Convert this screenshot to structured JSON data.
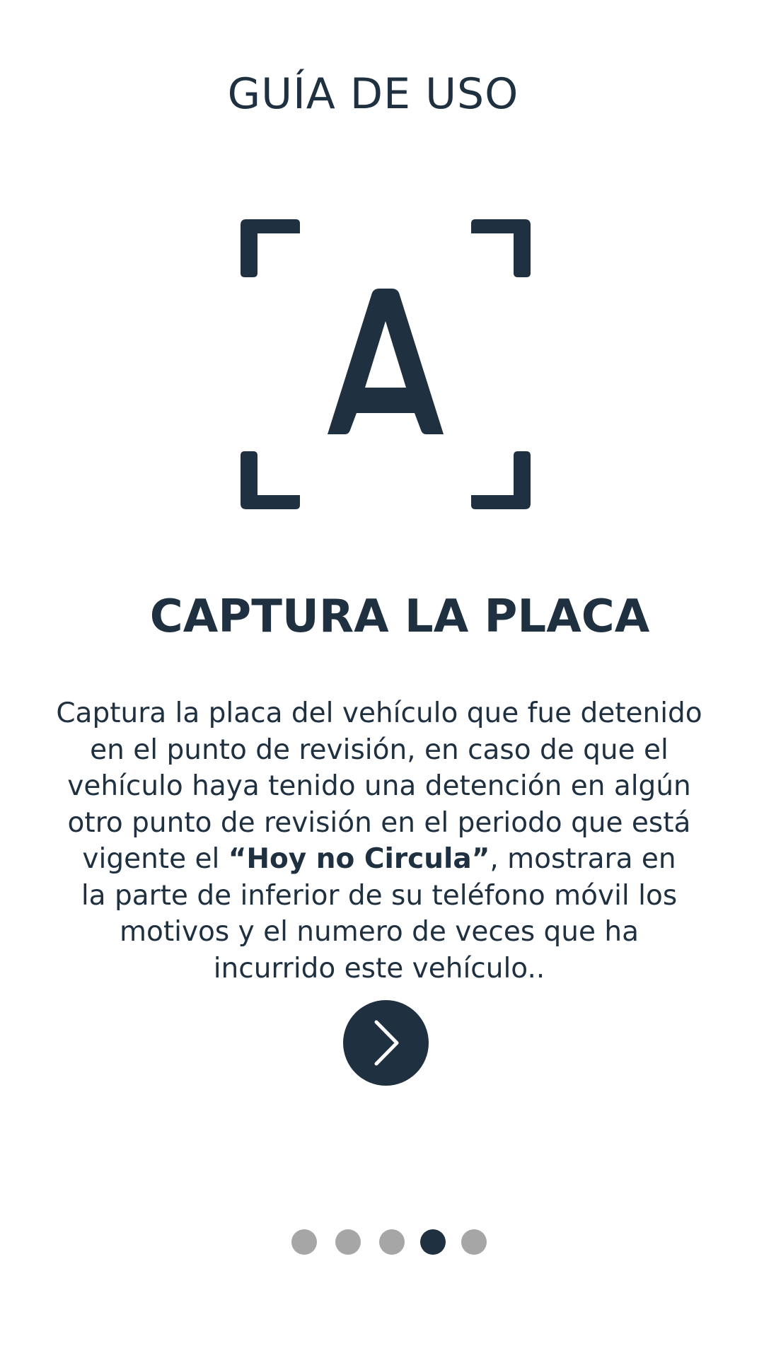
{
  "header": {
    "title": "GUÍA DE USO"
  },
  "step": {
    "icon": "scan-letter-a-icon",
    "icon_letter": "A",
    "heading": "CAPTURA LA PLACA",
    "description": {
      "line1": "Captura la placa del vehículo que fue detenido",
      "line2": "en el punto de revisión, en caso de que el",
      "line3": "vehículo haya tenido una detención en algún",
      "line4": "otro punto de revisión en el periodo que está",
      "line5_pre": "vigente el ",
      "line5_bold": "“Hoy no Circula”",
      "line5_post": ", mostrara en",
      "line6": "la parte de inferior de su teléfono móvil los",
      "line7": "motivos y el numero de veces que ha",
      "line8": "incurrido este vehículo.."
    }
  },
  "next_button": {
    "icon": "chevron-right-icon"
  },
  "pager": {
    "total": 5,
    "current": 4
  },
  "colors": {
    "primary": "#1f3040",
    "inactive_dot": "#a6a6a6",
    "background": "#ffffff"
  }
}
